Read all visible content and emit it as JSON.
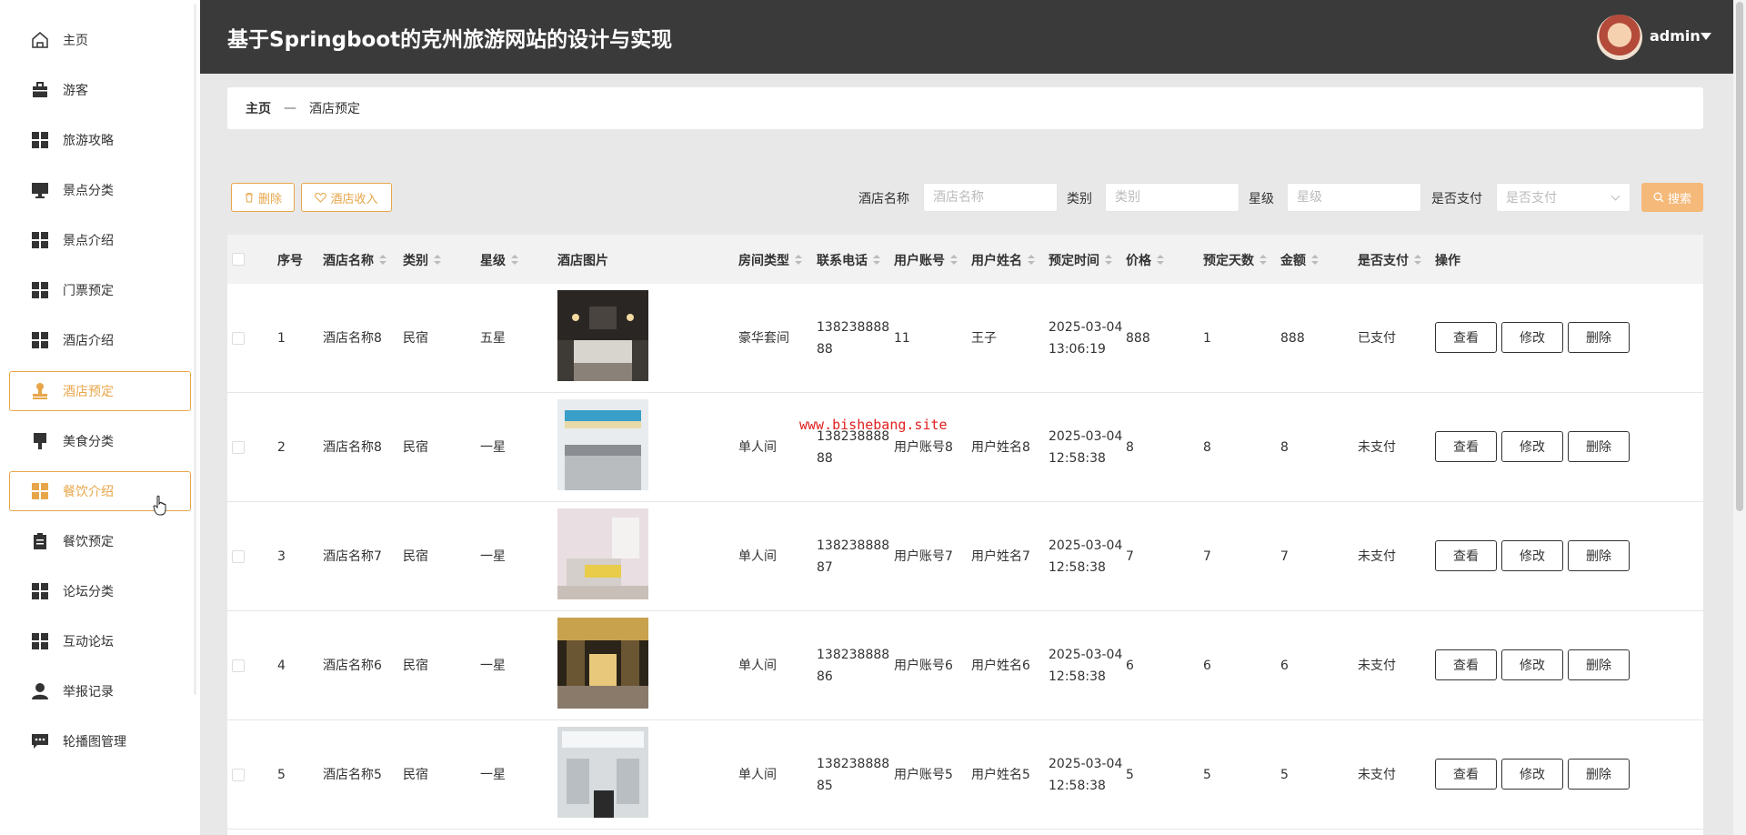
{
  "header": {
    "title": "基于Springboot的克州旅游网站的设计与实现",
    "username": "admin"
  },
  "sidebar": {
    "items": [
      {
        "label": "主页",
        "icon": "home-icon",
        "active": false
      },
      {
        "label": "游客",
        "icon": "briefcase-icon",
        "active": false
      },
      {
        "label": "旅游攻略",
        "icon": "grid-icon",
        "active": false
      },
      {
        "label": "景点分类",
        "icon": "monitor-icon",
        "active": false
      },
      {
        "label": "景点介绍",
        "icon": "grid-icon",
        "active": false
      },
      {
        "label": "门票预定",
        "icon": "grid-icon",
        "active": false
      },
      {
        "label": "酒店介绍",
        "icon": "grid-icon",
        "active": false
      },
      {
        "label": "酒店预定",
        "icon": "stamp-icon",
        "active": true
      },
      {
        "label": "美食分类",
        "icon": "brush-icon",
        "active": false
      },
      {
        "label": "餐饮介绍",
        "icon": "grid-icon",
        "active": true
      },
      {
        "label": "餐饮预定",
        "icon": "clipboard-icon",
        "active": false
      },
      {
        "label": "论坛分类",
        "icon": "grid-icon",
        "active": false
      },
      {
        "label": "互动论坛",
        "icon": "grid-icon",
        "active": false
      },
      {
        "label": "举报记录",
        "icon": "user-icon",
        "active": false
      },
      {
        "label": "轮播图管理",
        "icon": "chat-icon",
        "active": false
      }
    ]
  },
  "breadcrumb": {
    "home": "主页",
    "separator": "—",
    "current": "酒店预定"
  },
  "toolbar": {
    "delete_label": "删除",
    "income_label": "酒店收入",
    "search_label": "搜索"
  },
  "filters": {
    "hotel_name": {
      "label": "酒店名称",
      "placeholder": "酒店名称"
    },
    "category": {
      "label": "类别",
      "placeholder": "类别"
    },
    "star": {
      "label": "星级",
      "placeholder": "星级"
    },
    "paid": {
      "label": "是否支付",
      "placeholder": "是否支付"
    }
  },
  "table": {
    "columns": [
      "序号",
      "酒店名称",
      "类别",
      "星级",
      "酒店图片",
      "房间类型",
      "联系电话",
      "用户账号",
      "用户姓名",
      "预定时间",
      "价格",
      "预定天数",
      "金额",
      "是否支付",
      "操作"
    ],
    "rows": [
      {
        "no": "1",
        "hotel": "酒店名称8",
        "category": "民宿",
        "star": "五星",
        "room": "豪华套间",
        "phone1": "138238888",
        "phone2": "88",
        "account": "11",
        "name": "王子",
        "date": "2025-03-04",
        "time": "13:06:19",
        "price": "888",
        "days": "1",
        "amount": "888",
        "paid": "已支付"
      },
      {
        "no": "2",
        "hotel": "酒店名称8",
        "category": "民宿",
        "star": "一星",
        "room": "单人间",
        "phone1": "138238888",
        "phone2": "88",
        "account": "用户账号8",
        "name": "用户姓名8",
        "date": "2025-03-04",
        "time": "12:58:38",
        "price": "8",
        "days": "8",
        "amount": "8",
        "paid": "未支付"
      },
      {
        "no": "3",
        "hotel": "酒店名称7",
        "category": "民宿",
        "star": "一星",
        "room": "单人间",
        "phone1": "138238888",
        "phone2": "87",
        "account": "用户账号7",
        "name": "用户姓名7",
        "date": "2025-03-04",
        "time": "12:58:38",
        "price": "7",
        "days": "7",
        "amount": "7",
        "paid": "未支付"
      },
      {
        "no": "4",
        "hotel": "酒店名称6",
        "category": "民宿",
        "star": "一星",
        "room": "单人间",
        "phone1": "138238888",
        "phone2": "86",
        "account": "用户账号6",
        "name": "用户姓名6",
        "date": "2025-03-04",
        "time": "12:58:38",
        "price": "6",
        "days": "6",
        "amount": "6",
        "paid": "未支付"
      },
      {
        "no": "5",
        "hotel": "酒店名称5",
        "category": "民宿",
        "star": "一星",
        "room": "单人间",
        "phone1": "138238888",
        "phone2": "85",
        "account": "用户账号5",
        "name": "用户姓名5",
        "date": "2025-03-04",
        "time": "12:58:38",
        "price": "5",
        "days": "5",
        "amount": "5",
        "paid": "未支付"
      }
    ],
    "actions": {
      "view": "查看",
      "edit": "修改",
      "delete": "删除"
    }
  },
  "watermark": "www.bishebang.site",
  "colors": {
    "accent": "#e8a64a",
    "header_bg": "#3a3a3a",
    "search_bg": "#f5b97a"
  }
}
